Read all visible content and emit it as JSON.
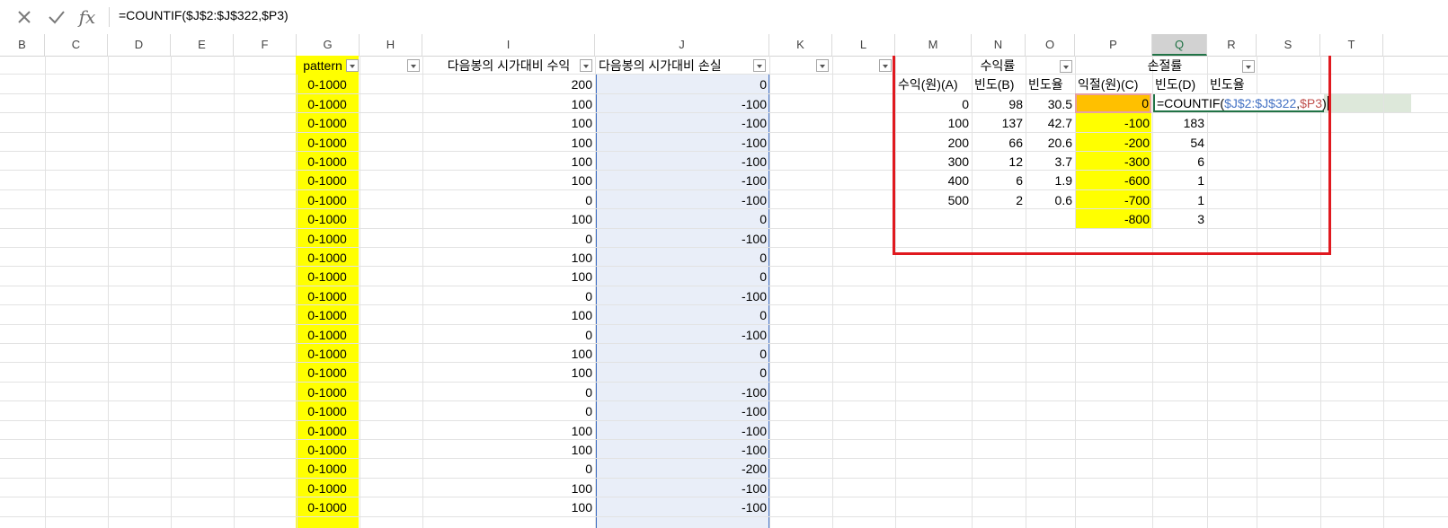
{
  "formula_bar": {
    "cancel_icon": "x-icon",
    "enter_icon": "check-icon",
    "function_label": "fx",
    "formula": "=COUNTIF($J$2:$J$322,$P3)"
  },
  "columns": [
    "B",
    "C",
    "D",
    "E",
    "F",
    "G",
    "H",
    "I",
    "J",
    "K",
    "L",
    "M",
    "N",
    "O",
    "P",
    "Q",
    "R",
    "S",
    "T"
  ],
  "selected_column": "Q",
  "headers": {
    "g": "pattern",
    "i": "다음봉의 시가대비 수익",
    "j": "다음봉의 시가대비 손실",
    "profit_group": "수익률",
    "loss_group": "손절률"
  },
  "profit_table": {
    "headers": [
      "수익(원)(A)",
      "빈도(B)",
      "빈도율"
    ],
    "rows": [
      [
        "0",
        "98",
        "30.5"
      ],
      [
        "100",
        "137",
        "42.7"
      ],
      [
        "200",
        "66",
        "20.6"
      ],
      [
        "300",
        "12",
        "3.7"
      ],
      [
        "400",
        "6",
        "1.9"
      ],
      [
        "500",
        "2",
        "0.6"
      ]
    ]
  },
  "loss_table": {
    "headers": [
      "익절(원)(C)",
      "빈도(D)",
      "빈도율"
    ],
    "rows": [
      [
        "0",
        ""
      ],
      [
        "-100",
        "183"
      ],
      [
        "-200",
        "54"
      ],
      [
        "-300",
        "6"
      ],
      [
        "-600",
        "1"
      ],
      [
        "-700",
        "1"
      ],
      [
        "-800",
        "3"
      ]
    ],
    "editing_cell": {
      "prefix": "=COUNTIF(",
      "range": "$J$2:$J$322",
      "comma": ",",
      "ref": "$P3",
      "suffix": ")"
    }
  },
  "data_rows": [
    [
      "0-1000",
      "200",
      "0"
    ],
    [
      "0-1000",
      "100",
      "-100"
    ],
    [
      "0-1000",
      "100",
      "-100"
    ],
    [
      "0-1000",
      "100",
      "-100"
    ],
    [
      "0-1000",
      "100",
      "-100"
    ],
    [
      "0-1000",
      "100",
      "-100"
    ],
    [
      "0-1000",
      "0",
      "-100"
    ],
    [
      "0-1000",
      "100",
      "0"
    ],
    [
      "0-1000",
      "0",
      "-100"
    ],
    [
      "0-1000",
      "100",
      "0"
    ],
    [
      "0-1000",
      "100",
      "0"
    ],
    [
      "0-1000",
      "0",
      "-100"
    ],
    [
      "0-1000",
      "100",
      "0"
    ],
    [
      "0-1000",
      "0",
      "-100"
    ],
    [
      "0-1000",
      "100",
      "0"
    ],
    [
      "0-1000",
      "100",
      "0"
    ],
    [
      "0-1000",
      "0",
      "-100"
    ],
    [
      "0-1000",
      "0",
      "-100"
    ],
    [
      "0-1000",
      "100",
      "-100"
    ],
    [
      "0-1000",
      "100",
      "-100"
    ],
    [
      "0-1000",
      "0",
      "-200"
    ],
    [
      "0-1000",
      "100",
      "-100"
    ],
    [
      "0-1000",
      "100",
      "-100"
    ]
  ],
  "colors": {
    "highlight_yellow": "#ffff00",
    "selected_column_fill": "#e9eef8",
    "callout_red": "#e0191f",
    "excel_green": "#217346",
    "range_blue": "#4472c4",
    "ref_red": "#c0504d"
  }
}
